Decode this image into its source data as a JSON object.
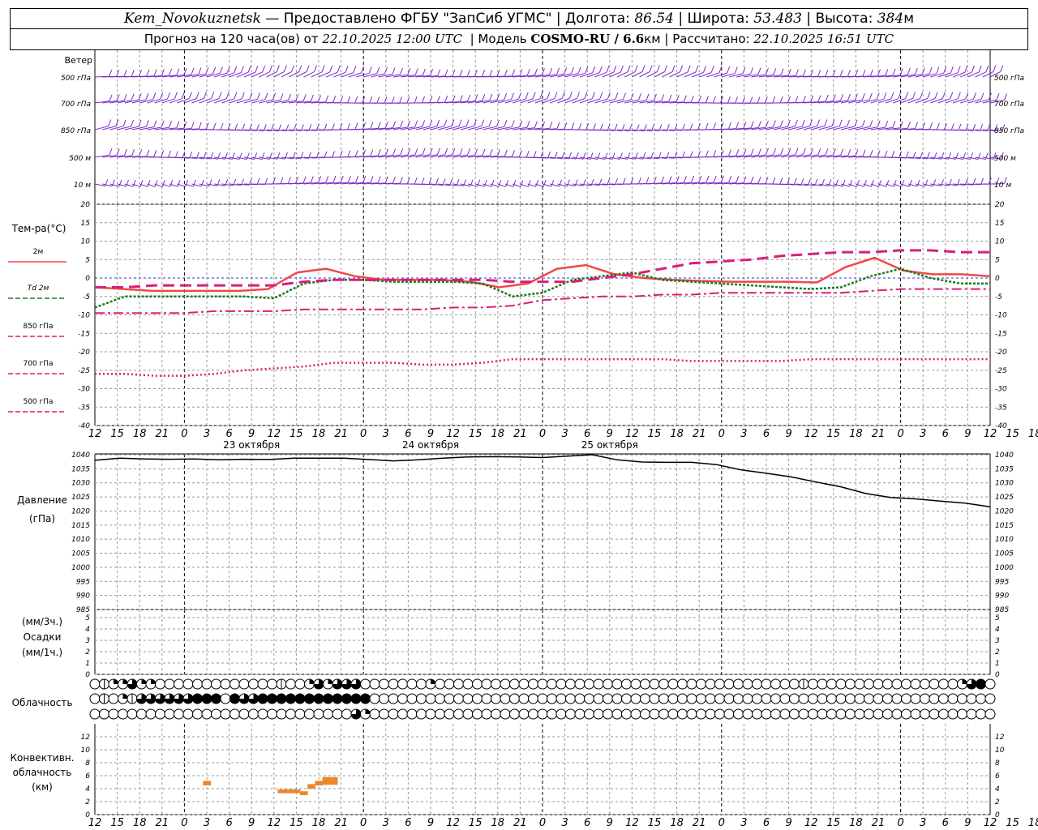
{
  "header": {
    "station": "Kem_Novokuznetsk",
    "provider": " — Предоставлено ФГБУ \"ЗапСиб УГМС\"",
    "lon_label": "Долгота: ",
    "lon": "86.54",
    "lat_label": "Широта: ",
    "lat": "53.483",
    "alt_label": "Высота: ",
    "alt": "384",
    "alt_unit": "м",
    "forecast_label": "Прогноз на 120 часа(ов) от ",
    "run_time": "22.10.2025 12:00 UTC",
    "model_label": "Модель ",
    "model": "COSMO-RU / 6.6",
    "model_unit": "км",
    "computed_label": "Рассчитано: ",
    "computed_time": "22.10.2025 16:51 UTC"
  },
  "labels": {
    "wind": "Ветер",
    "wind_levels": [
      "500 гПа",
      "700 гПа",
      "850 гПа",
      "500 м",
      "10 м"
    ],
    "temp_title": "Тем-ра(°C)",
    "temp_legend": [
      "2м",
      "Td 2м",
      "850 гПа",
      "700 гПа",
      "500 гПа"
    ],
    "pressure": [
      "Давление",
      "(гПа)"
    ],
    "precip": [
      "(мм/3ч.)",
      "Осадки",
      "(мм/1ч.)"
    ],
    "cloud": "Облачность",
    "conv": [
      "Конвективн.",
      "облачность",
      "(км)"
    ]
  },
  "colors": {
    "wind": "#7b2bc9",
    "t2m": "#f04848",
    "td2m": "#1a7a1a",
    "t850": "#d81e7a",
    "pressure": "#000000",
    "conv": "#e8892a",
    "grid": "#999999"
  },
  "chart_data": [
    {
      "type": "line",
      "title": "Тем-ра(°C)",
      "x_hours": [
        0,
        3,
        6,
        9,
        12,
        15,
        18,
        21,
        24,
        27,
        30,
        33,
        36,
        39,
        42,
        45,
        48,
        51,
        54,
        57,
        60,
        63,
        66,
        69,
        72,
        75,
        78,
        81,
        84,
        87,
        90,
        93,
        96,
        99,
        102,
        105,
        108,
        111,
        114,
        117,
        120
      ],
      "xticks": [
        "12",
        "15",
        "18",
        "21",
        "0",
        "3",
        "6",
        "9",
        "12",
        "15",
        "18",
        "21",
        "0",
        "3",
        "6",
        "9",
        "12",
        "15",
        "18",
        "21",
        "0",
        "3",
        "6",
        "9",
        "12",
        "15",
        "18",
        "21",
        "0",
        "3",
        "6",
        "9",
        "12",
        "15",
        "18",
        "21",
        "0",
        "3",
        "6",
        "9",
        "12",
        "15",
        "18"
      ],
      "dates": [
        "23 октября",
        "24 октября",
        "25 октября"
      ],
      "ylim": [
        -40,
        20
      ],
      "yticks": [
        20,
        15,
        10,
        5,
        0,
        -5,
        -10,
        -15,
        -20,
        -25,
        -30,
        -35,
        -40
      ],
      "series": [
        {
          "name": "2м",
          "values": [
            -2.5,
            -3,
            -3.5,
            -3.5,
            -3.5,
            -3.5,
            -3,
            1.5,
            2.5,
            0.5,
            -0.5,
            -0.5,
            -0.5,
            -1,
            -2.5,
            -1.5,
            2.5,
            3.5,
            1,
            0,
            -0.5,
            -0.8,
            -1,
            -1,
            -1,
            -1.2,
            3,
            5.5,
            2,
            1,
            1,
            0.5
          ]
        },
        {
          "name": "Td 2м",
          "values": [
            -8,
            -5,
            -5,
            -5,
            -5,
            -5,
            -5.5,
            -1.5,
            -0.5,
            -0.5,
            -1,
            -1,
            -1,
            -1.5,
            -5,
            -4,
            -0.5,
            0.5,
            1.5,
            -0.5,
            -1,
            -1.5,
            -2,
            -2.5,
            -3,
            -2.5,
            0.5,
            2.5,
            0,
            -1.5,
            -1.5
          ]
        },
        {
          "name": "850 гПа",
          "values": [
            -2.5,
            -2.5,
            -2,
            -2,
            -2,
            -2,
            -2,
            -1,
            -0.5,
            -0.5,
            -0.5,
            -0.5,
            -0.5,
            -0.5,
            -1,
            -1,
            -1,
            0,
            1,
            2.5,
            4,
            4.5,
            5,
            6,
            6.5,
            7,
            7,
            7.5,
            7.5,
            7,
            7
          ]
        },
        {
          "name": "700 гПа",
          "values": [
            -9.5,
            -9.5,
            -9.5,
            -9.5,
            -9,
            -9,
            -9,
            -8.5,
            -8.5,
            -8.5,
            -8.5,
            -8.5,
            -8,
            -8,
            -7.5,
            -6,
            -5.5,
            -5,
            -5,
            -4.5,
            -4.5,
            -4,
            -4,
            -4,
            -4,
            -4,
            -3.5,
            -3,
            -3,
            -3,
            -3
          ]
        },
        {
          "name": "500 гПа",
          "values": [
            -26,
            -26,
            -26.5,
            -26.5,
            -26,
            -25,
            -24.5,
            -24,
            -23,
            -23,
            -23,
            -23.5,
            -23.5,
            -23,
            -22,
            -22,
            -22,
            -22,
            -22,
            -22,
            -22.5,
            -22.5,
            -22.5,
            -22.5,
            -22,
            -22,
            -22,
            -22,
            -22,
            -22,
            -22
          ]
        }
      ]
    },
    {
      "type": "line",
      "title": "Давление (гПа)",
      "ylim": [
        985,
        1040
      ],
      "yticks": [
        1040,
        1035,
        1030,
        1025,
        1020,
        1015,
        1010,
        1005,
        1000,
        995,
        990,
        985
      ],
      "values": [
        1038,
        1038.8,
        1038.5,
        1038.4,
        1038.5,
        1038.2,
        1038.4,
        1038.3,
        1038.8,
        1038.8,
        1038.8,
        1038.3,
        1037.8,
        1038.2,
        1038.8,
        1039.2,
        1039.3,
        1039.2,
        1039,
        1039.5,
        1040,
        1038.2,
        1037.4,
        1037.3,
        1037.3,
        1036.5,
        1034.6,
        1033.4,
        1032.1,
        1030.3,
        1028.6,
        1026.2,
        1024.8,
        1024.3,
        1023.5,
        1022.8,
        1021.5
      ]
    },
    {
      "type": "bar",
      "title": "Осадки",
      "ylim": [
        0,
        5
      ],
      "yticks": [
        5,
        4,
        3,
        2,
        1,
        0
      ],
      "values": []
    },
    {
      "type": "bar",
      "title": "Конвективн. облачность (км)",
      "ylim": [
        0,
        14
      ],
      "yticks": [
        12,
        10,
        8,
        6,
        4,
        2,
        0
      ],
      "bars": [
        {
          "hour": 15,
          "base": 4.5,
          "top": 5.2
        },
        {
          "hour": 25,
          "base": 3.3,
          "top": 3.9
        },
        {
          "hour": 26,
          "base": 3.3,
          "top": 3.9
        },
        {
          "hour": 27,
          "base": 3.3,
          "top": 3.9
        },
        {
          "hour": 28,
          "base": 3.0,
          "top": 3.6
        },
        {
          "hour": 29,
          "base": 4.0,
          "top": 4.7
        },
        {
          "hour": 30,
          "base": 4.5,
          "top": 5.2
        },
        {
          "hour": 31,
          "base": 4.6,
          "top": 5.8
        },
        {
          "hour": 32,
          "base": 4.6,
          "top": 5.8
        }
      ]
    }
  ],
  "cloud_cover_rows": [
    "0122322000000000000010023233300000002000000000000000000000000000000000000000100000000000000002340",
    "0102133333344404334444444444440000000000000000000000000000000000000000000000000000000000000000000",
    "0000000000000000000000000000320000000000000000000000000000000000000000000000000000000000000000000"
  ]
}
